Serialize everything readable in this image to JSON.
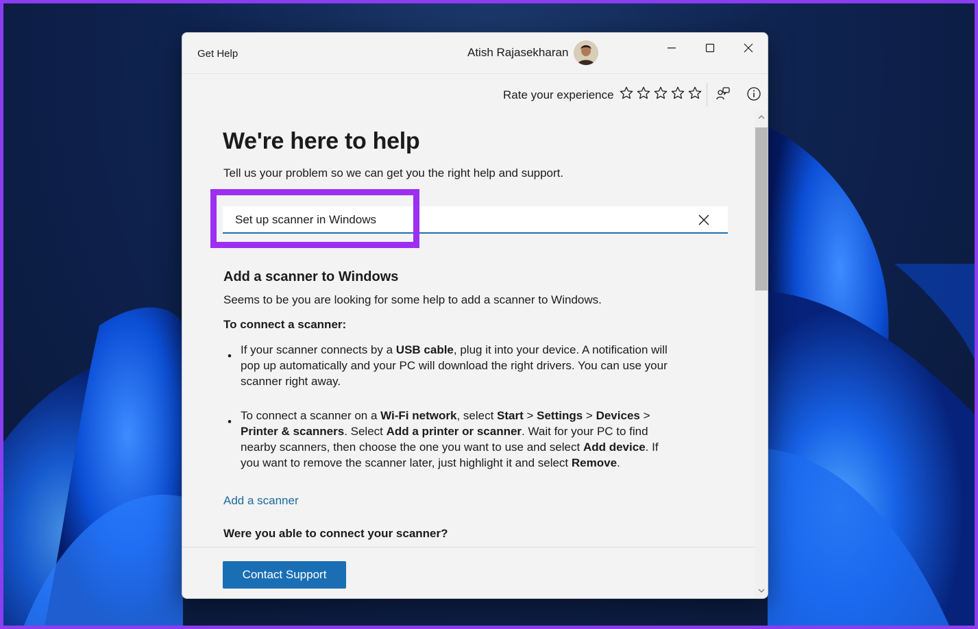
{
  "window": {
    "app_title": "Get Help",
    "user_name": "Atish Rajasekharan"
  },
  "toolbar": {
    "rate_label": "Rate your experience",
    "stars": [
      {
        "name": "star-1"
      },
      {
        "name": "star-2"
      },
      {
        "name": "star-3"
      },
      {
        "name": "star-4"
      },
      {
        "name": "star-5"
      }
    ]
  },
  "main": {
    "heading": "We're here to help",
    "subheading": "Tell us your problem so we can get you the right help and support.",
    "search": {
      "value": "Set up scanner in Windows"
    },
    "result": {
      "title": "Add a scanner to Windows",
      "description": "Seems to be you are looking for some help to add a scanner to Windows.",
      "connect_heading": "To connect a scanner:",
      "bullet_1": {
        "t1": "If your scanner connects by a ",
        "b1": "USB cable",
        "t2": ", plug it into your device. A notification will pop up automatically and your PC will download the right drivers. You can use your scanner right away."
      },
      "bullet_2": {
        "t1": "To connect a scanner on a ",
        "b1": "Wi-Fi network",
        "t2": ", select ",
        "b2": "Start",
        "t3": " > ",
        "b3": "Settings",
        "t4": " > ",
        "b4": "Devices",
        "t5": " > ",
        "b5": "Printer & scanners",
        "t6": ". Select ",
        "b6": "Add a printer or scanner",
        "t7": ". Wait for your PC to find nearby scanners, then choose the one you want to use and select ",
        "b7": "Add device",
        "t8": ". If you want to remove the scanner later, just highlight it and select ",
        "b8": "Remove",
        "t9": "."
      },
      "link_label": "Add a scanner",
      "question": "Were you able to connect your scanner?"
    }
  },
  "footer": {
    "contact_label": "Contact Support"
  },
  "colors": {
    "accent": "#1a6fb4",
    "highlight": "#9c2ff2",
    "link": "#1d6a9e"
  }
}
